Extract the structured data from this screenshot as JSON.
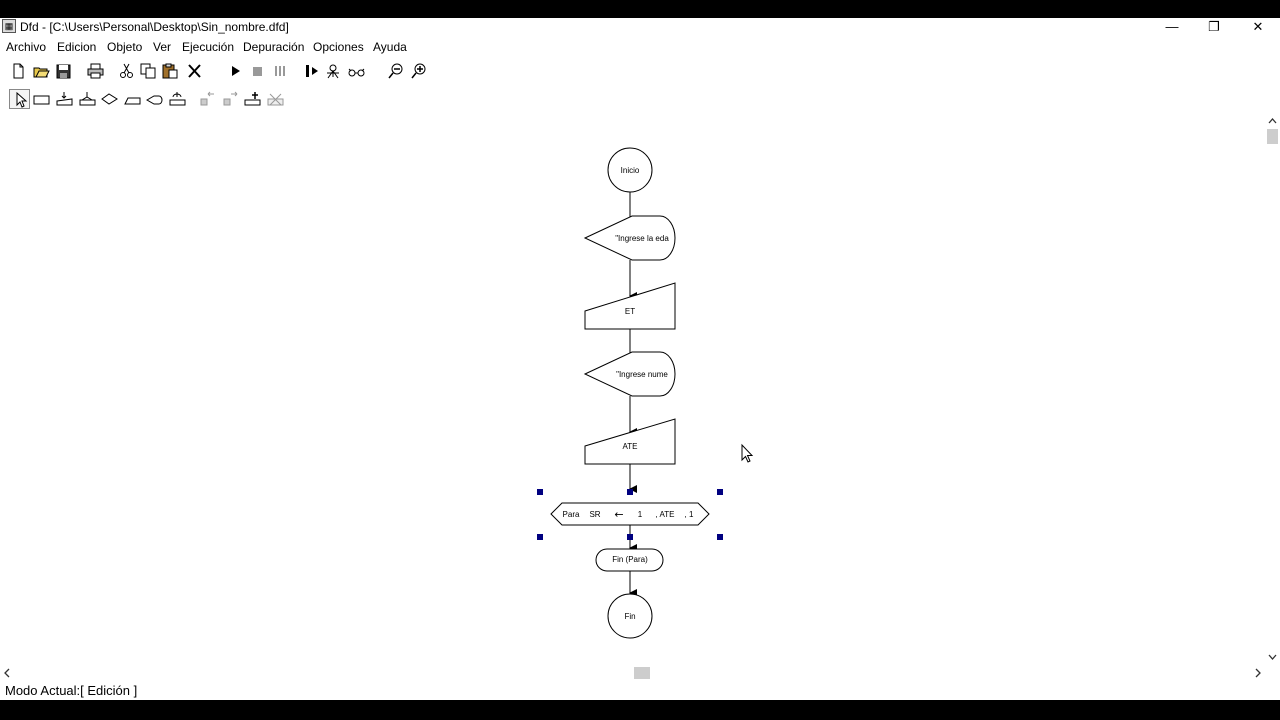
{
  "window": {
    "title": "Dfd - [C:\\Users\\Personal\\Desktop\\Sin_nombre.dfd]",
    "minimize": "—",
    "restore": "❐",
    "close": "✕"
  },
  "menu": [
    "Archivo",
    "Edicion",
    "Objeto",
    "Ver",
    "Ejecución",
    "Depuración",
    "Opciones",
    "Ayuda"
  ],
  "toolbar1": [
    "new-file-icon",
    "open-folder-icon",
    "save-icon",
    "print-icon",
    "cut-icon",
    "copy-icon",
    "paste-icon",
    "delete-icon",
    "run-icon",
    "stop-icon",
    "pause-icon",
    "step-icon",
    "debug-icon",
    "watch-icon",
    "zoom-out-icon",
    "zoom-in-icon"
  ],
  "toolbar2": [
    "pointer-icon",
    "assignment-icon",
    "read-icon",
    "output-icon",
    "decision-icon",
    "while-icon",
    "for-icon",
    "subprogram-icon",
    "move-left-icon",
    "move-right-icon",
    "insert-icon",
    "remove-icon"
  ],
  "flowchart": {
    "start": "Inicio",
    "output1": "\"Ingrese la eda",
    "read1": "ET",
    "output2": "\"Ingrese nume",
    "read2": "ATE",
    "for_label": "Para",
    "for_var": "SR",
    "for_arrow": "←",
    "for_init": "1",
    "for_end": ", ATE",
    "for_step": ", 1",
    "end_for": "Fin (Para)",
    "end": "Fin"
  },
  "status": "Modo Actual:[ Edición ]"
}
